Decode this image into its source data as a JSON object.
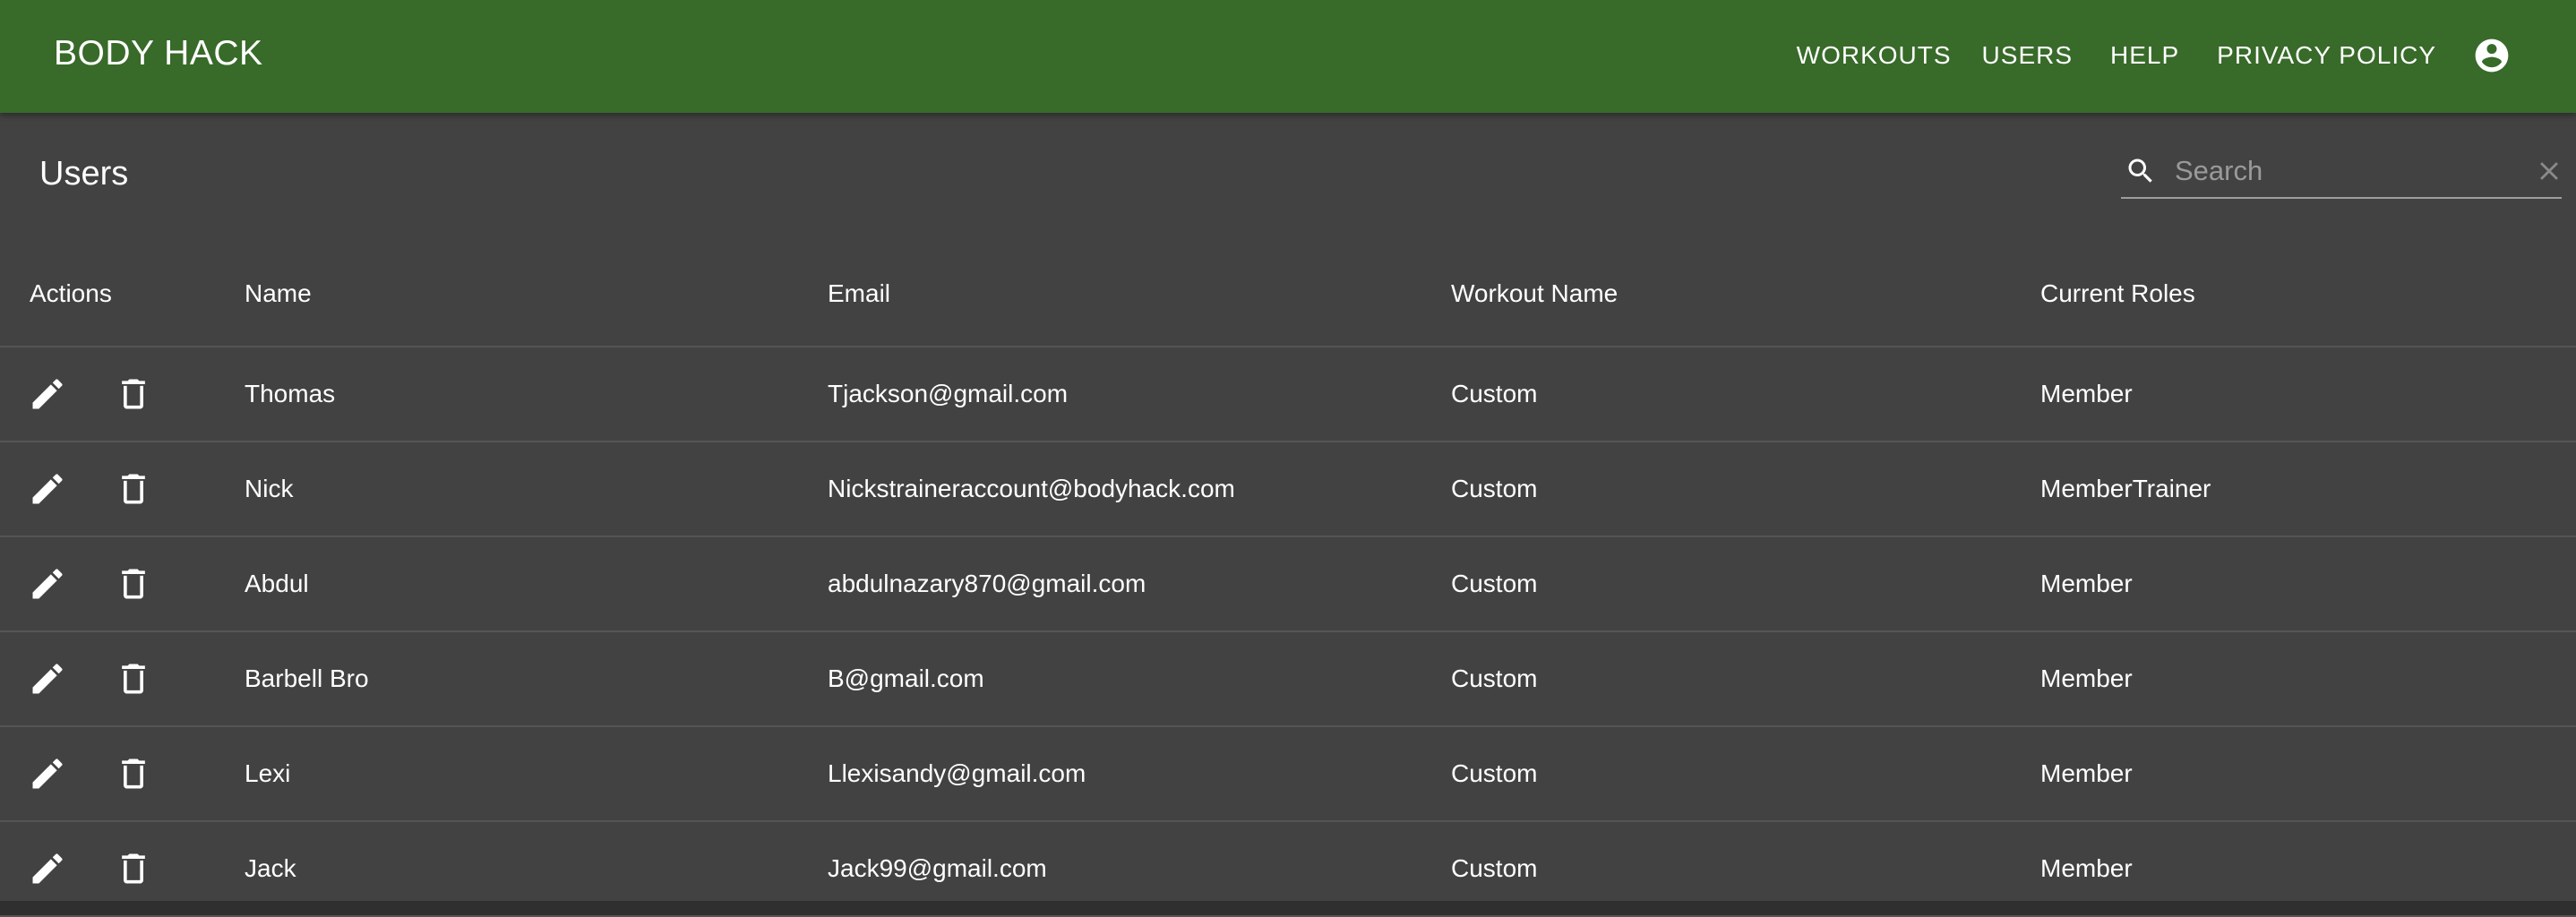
{
  "app": {
    "brand": "BODY HACK",
    "nav": [
      {
        "label": "WORKOUTS"
      },
      {
        "label": "USERS"
      },
      {
        "label": "HELP"
      },
      {
        "label": "PRIVACY POLICY"
      }
    ],
    "account_icon": "account-circle-icon"
  },
  "page": {
    "title": "Users",
    "search": {
      "placeholder": "Search",
      "value": ""
    }
  },
  "table": {
    "columns": [
      "Actions",
      "Name",
      "Email",
      "Workout Name",
      "Current Roles"
    ],
    "rows": [
      {
        "name": "Thomas",
        "email": "Tjackson@gmail.com",
        "workout": "Custom",
        "roles": "Member"
      },
      {
        "name": "Nick",
        "email": "Nickstraineraccount@bodyhack.com",
        "workout": "Custom",
        "roles": "MemberTrainer"
      },
      {
        "name": "Abdul",
        "email": "abdulnazary870@gmail.com",
        "workout": "Custom",
        "roles": "Member"
      },
      {
        "name": "Barbell Bro",
        "email": "B@gmail.com",
        "workout": "Custom",
        "roles": "Member"
      },
      {
        "name": "Lexi",
        "email": "Llexisandy@gmail.com",
        "workout": "Custom",
        "roles": "Member"
      },
      {
        "name": "Jack",
        "email": "Jack99@gmail.com",
        "workout": "Custom",
        "roles": "Member"
      }
    ],
    "row_actions": [
      "edit-icon",
      "delete-icon"
    ]
  },
  "colors": {
    "appbar": "#386a29",
    "panel": "#424242",
    "text": "#ffffff",
    "divider": "#555555"
  }
}
